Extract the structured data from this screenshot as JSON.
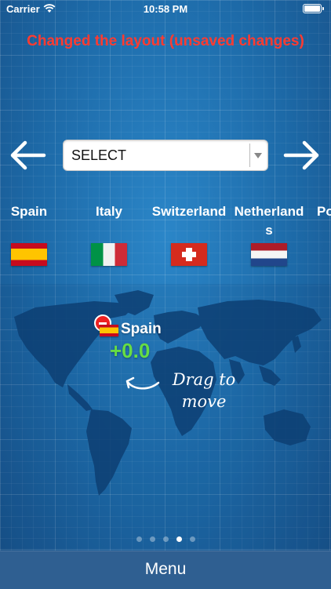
{
  "status_bar": {
    "carrier": "Carrier",
    "time": "10:58 PM"
  },
  "banner": {
    "text": "Changed the layout (unsaved changes)",
    "color": "#ff3b30"
  },
  "selector": {
    "value": "SELECT"
  },
  "countries": [
    {
      "name": "Spain",
      "flag": "flag-spain"
    },
    {
      "name": "Italy",
      "flag": "flag-italy"
    },
    {
      "name": "Switzerland",
      "flag": "flag-switzerland"
    },
    {
      "name": "Netherlands",
      "flag": "flag-netherlands"
    },
    {
      "name": "Po",
      "flag": ""
    }
  ],
  "map_marker": {
    "country": "Spain",
    "offset": "+0.0",
    "offset_color": "#66dd44"
  },
  "drag_hint": "Drag to move",
  "pager": {
    "count": 5,
    "active_index": 3
  },
  "menu": {
    "label": "Menu"
  }
}
